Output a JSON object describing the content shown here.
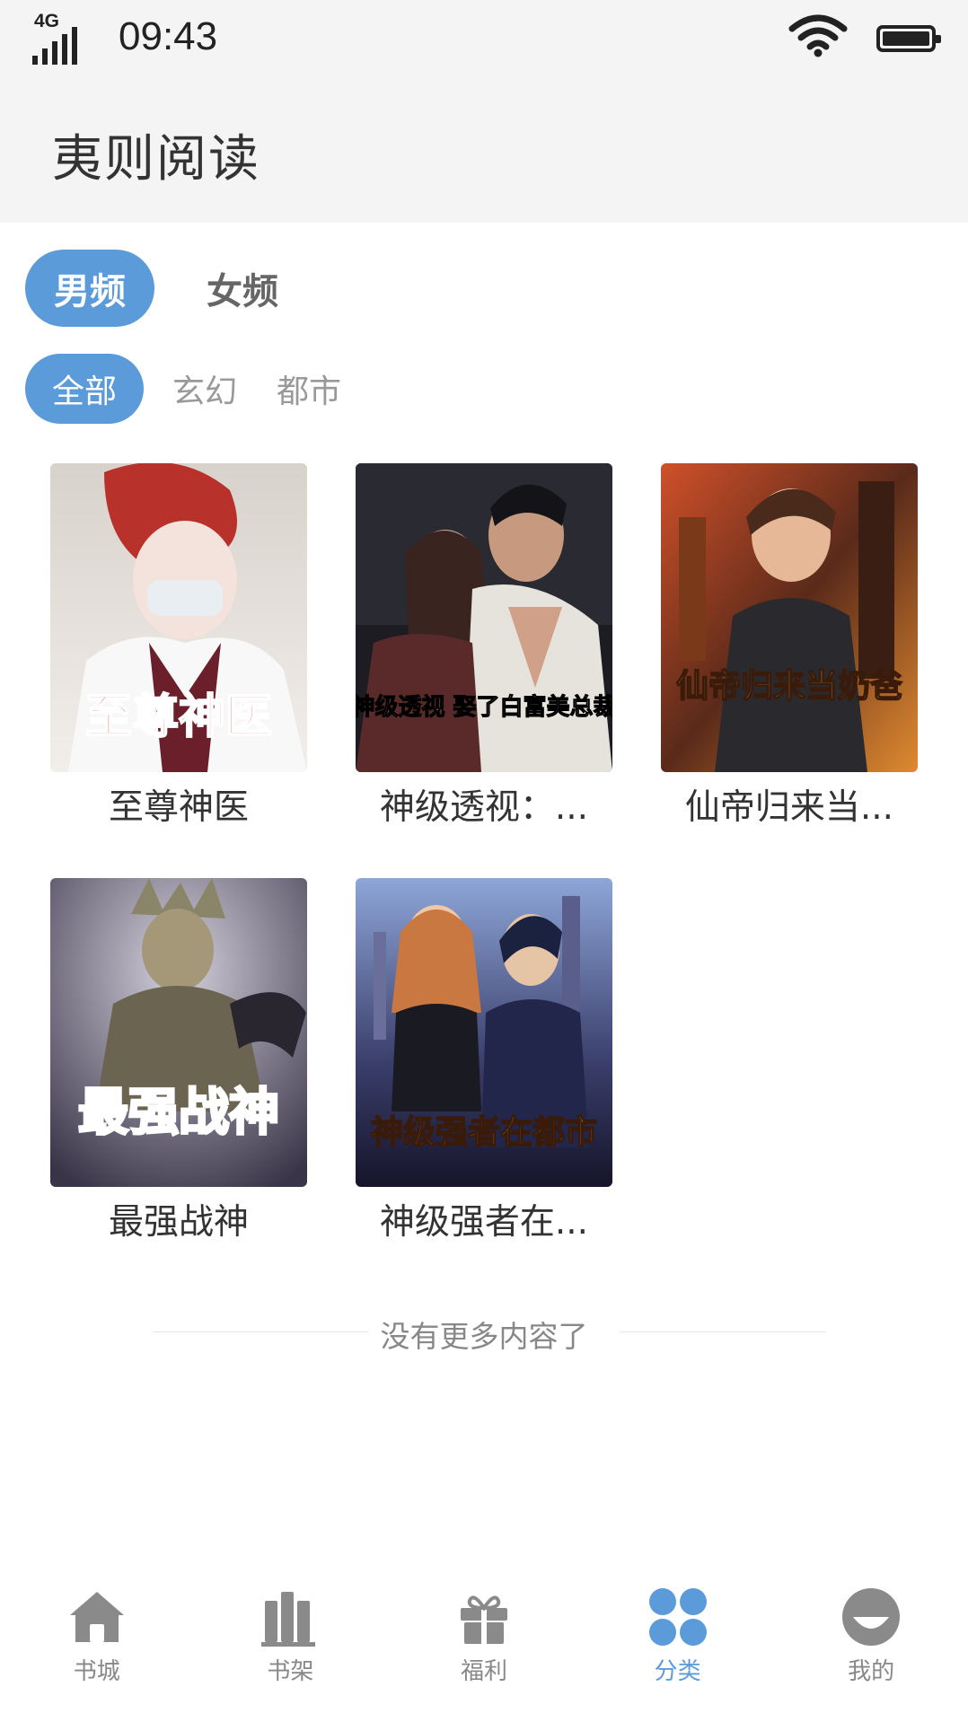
{
  "status_bar": {
    "network": "4G",
    "time": "09:43"
  },
  "header": {
    "title": "夷则阅读"
  },
  "gender_tabs": [
    {
      "label": "男频",
      "active": true
    },
    {
      "label": "女频",
      "active": false
    }
  ],
  "category_tabs": [
    {
      "label": "全部",
      "active": true
    },
    {
      "label": "玄幻",
      "active": false
    },
    {
      "label": "都市",
      "active": false
    }
  ],
  "books": [
    {
      "title": "至尊神医",
      "cover_text": "至尊神医"
    },
    {
      "title": "神级透视：...",
      "cover_text": "神级透视 娶了白富美总裁"
    },
    {
      "title": "仙帝归来当...",
      "cover_text": "仙帝归来当奶爸"
    },
    {
      "title": "最强战神",
      "cover_text": "最强战神"
    },
    {
      "title": "神级强者在...",
      "cover_text": "神级强者在都市"
    }
  ],
  "end_note": "没有更多内容了",
  "bottom_nav": [
    {
      "label": "书城",
      "icon": "home-icon",
      "active": false
    },
    {
      "label": "书架",
      "icon": "bookshelf-icon",
      "active": false
    },
    {
      "label": "福利",
      "icon": "gift-icon",
      "active": false
    },
    {
      "label": "分类",
      "icon": "category-grid-icon",
      "active": true
    },
    {
      "label": "我的",
      "icon": "profile-icon",
      "active": false
    }
  ],
  "colors": {
    "accent": "#5b9bd9",
    "header_bg": "#f4f4f4",
    "inactive": "#888888"
  }
}
